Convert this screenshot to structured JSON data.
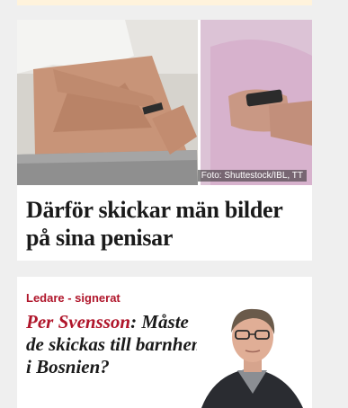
{
  "articles": [
    {
      "image": {
        "credit": "Foto: Shuttestock/IBL, TT"
      },
      "headline": "Därför skickar män bilder på sina penisar"
    },
    {
      "kicker": "Ledare - signerat",
      "author": "Per Svensson",
      "separator": ":",
      "title": " Måste de skickas till barnhem i Bosnien?"
    }
  ]
}
